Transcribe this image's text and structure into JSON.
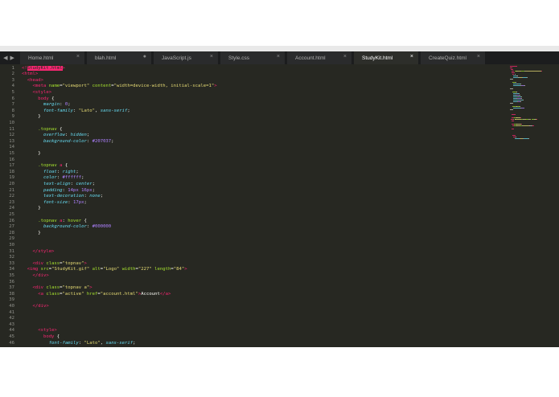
{
  "tabs": [
    {
      "label": "Home.html",
      "close": "×",
      "active": false
    },
    {
      "label": "blah.html",
      "close": "●",
      "active": false
    },
    {
      "label": "JavaScript.js",
      "close": "×",
      "active": false
    },
    {
      "label": "Style.css",
      "close": "×",
      "active": false
    },
    {
      "label": "Account.html",
      "close": "×",
      "active": false
    },
    {
      "label": "StudyKit.html",
      "close": "×",
      "active": true
    },
    {
      "label": "CreateQuiz.html",
      "close": "×",
      "active": false
    }
  ],
  "nav": {
    "back": "◀",
    "forward": "▶"
  },
  "lines": [
    {
      "n": "1",
      "segs": [
        [
          "t",
          "<!"
        ],
        [
          "hl",
          "StudyKit.html"
        ],
        [
          "t",
          ">"
        ]
      ]
    },
    {
      "n": "2",
      "segs": [
        [
          "t",
          "<html>"
        ]
      ]
    },
    {
      "n": "3",
      "segs": [
        [
          "",
          "  "
        ],
        [
          "t",
          "<head>"
        ]
      ]
    },
    {
      "n": "4",
      "segs": [
        [
          "",
          "    "
        ],
        [
          "t",
          "<meta "
        ],
        [
          "a",
          "name"
        ],
        [
          "",
          "="
        ],
        [
          "s",
          "\"viewport\""
        ],
        [
          "",
          " "
        ],
        [
          "a",
          "content"
        ],
        [
          "",
          "="
        ],
        [
          "s",
          "\"width=device-width, initial-scale=1\""
        ],
        [
          "t",
          ">"
        ]
      ]
    },
    {
      "n": "5",
      "segs": [
        [
          "",
          "    "
        ],
        [
          "t",
          "<style>"
        ]
      ]
    },
    {
      "n": "6",
      "segs": [
        [
          "",
          "      "
        ],
        [
          "t",
          "body"
        ],
        [
          "",
          " {"
        ]
      ]
    },
    {
      "n": "7",
      "segs": [
        [
          "",
          "        "
        ],
        [
          "p",
          "margin"
        ],
        [
          "",
          ": "
        ],
        [
          "n",
          "0"
        ],
        [
          "",
          ";"
        ]
      ]
    },
    {
      "n": "8",
      "segs": [
        [
          "",
          "        "
        ],
        [
          "p",
          "font-family"
        ],
        [
          "",
          ": "
        ],
        [
          "s",
          "\"Lato\""
        ],
        [
          "",
          ", "
        ],
        [
          "p",
          "sans-serif"
        ],
        [
          "",
          ";"
        ]
      ]
    },
    {
      "n": "9",
      "segs": [
        [
          "",
          "      }"
        ]
      ]
    },
    {
      "n": "10",
      "segs": [
        [
          "",
          ""
        ]
      ]
    },
    {
      "n": "11",
      "segs": [
        [
          "",
          "      "
        ],
        [
          "sel",
          ".topnav"
        ],
        [
          "",
          " {"
        ]
      ]
    },
    {
      "n": "12",
      "segs": [
        [
          "",
          "        "
        ],
        [
          "p",
          "overflow"
        ],
        [
          "",
          ": "
        ],
        [
          "p",
          "hidden"
        ],
        [
          "",
          ";"
        ]
      ]
    },
    {
      "n": "13",
      "segs": [
        [
          "",
          "        "
        ],
        [
          "p",
          "background-color"
        ],
        [
          "",
          ": "
        ],
        [
          "n",
          "#207037"
        ],
        [
          "",
          ";"
        ]
      ]
    },
    {
      "n": "14",
      "segs": [
        [
          "",
          ""
        ]
      ]
    },
    {
      "n": "15",
      "segs": [
        [
          "",
          "      }"
        ]
      ]
    },
    {
      "n": "16",
      "segs": [
        [
          "",
          ""
        ]
      ]
    },
    {
      "n": "17",
      "segs": [
        [
          "",
          "      "
        ],
        [
          "sel",
          ".topnav "
        ],
        [
          "t",
          "a"
        ],
        [
          "",
          " {"
        ]
      ]
    },
    {
      "n": "18",
      "segs": [
        [
          "",
          "        "
        ],
        [
          "p",
          "float"
        ],
        [
          "",
          ": "
        ],
        [
          "p",
          "right"
        ],
        [
          "",
          ";"
        ]
      ]
    },
    {
      "n": "19",
      "segs": [
        [
          "",
          "        "
        ],
        [
          "p",
          "color"
        ],
        [
          "",
          ": "
        ],
        [
          "n",
          "#ffffff"
        ],
        [
          "",
          ";"
        ]
      ]
    },
    {
      "n": "20",
      "segs": [
        [
          "",
          "        "
        ],
        [
          "p",
          "text-align"
        ],
        [
          "",
          ": "
        ],
        [
          "p",
          "center"
        ],
        [
          "",
          ";"
        ]
      ]
    },
    {
      "n": "21",
      "segs": [
        [
          "",
          "        "
        ],
        [
          "p",
          "padding"
        ],
        [
          "",
          ": "
        ],
        [
          "n",
          "14px 16px"
        ],
        [
          "",
          ";"
        ]
      ]
    },
    {
      "n": "22",
      "segs": [
        [
          "",
          "        "
        ],
        [
          "p",
          "text-decoration"
        ],
        [
          "",
          ": "
        ],
        [
          "p",
          "none"
        ],
        [
          "",
          ";"
        ]
      ]
    },
    {
      "n": "23",
      "segs": [
        [
          "",
          "        "
        ],
        [
          "p",
          "font-size"
        ],
        [
          "",
          ": "
        ],
        [
          "n",
          "17px"
        ],
        [
          "",
          ";"
        ]
      ]
    },
    {
      "n": "24",
      "segs": [
        [
          "",
          "      }"
        ]
      ]
    },
    {
      "n": "25",
      "segs": [
        [
          "",
          ""
        ]
      ]
    },
    {
      "n": "26",
      "segs": [
        [
          "",
          "      "
        ],
        [
          "sel",
          ".topnav "
        ],
        [
          "t",
          "a"
        ],
        [
          "",
          ": "
        ],
        [
          "a",
          "hover"
        ],
        [
          "",
          " {"
        ]
      ]
    },
    {
      "n": "27",
      "segs": [
        [
          "",
          "        "
        ],
        [
          "p",
          "background-color"
        ],
        [
          "",
          ": "
        ],
        [
          "n",
          "#000000"
        ]
      ]
    },
    {
      "n": "28",
      "segs": [
        [
          "",
          "      }"
        ]
      ]
    },
    {
      "n": "29",
      "segs": [
        [
          "",
          ""
        ]
      ]
    },
    {
      "n": "30",
      "segs": [
        [
          "",
          ""
        ]
      ]
    },
    {
      "n": "31",
      "segs": [
        [
          "",
          "    "
        ],
        [
          "t",
          "</style>"
        ]
      ]
    },
    {
      "n": "32",
      "segs": [
        [
          "",
          ""
        ]
      ]
    },
    {
      "n": "33",
      "segs": [
        [
          "",
          "    "
        ],
        [
          "t",
          "<div "
        ],
        [
          "a",
          "class"
        ],
        [
          "",
          "="
        ],
        [
          "s",
          "\"topnav\""
        ],
        [
          "t",
          ">"
        ]
      ]
    },
    {
      "n": "34",
      "segs": [
        [
          "",
          "  "
        ],
        [
          "t",
          "<img "
        ],
        [
          "a",
          "src"
        ],
        [
          "",
          "="
        ],
        [
          "s",
          "\"StudyKit.gif\""
        ],
        [
          "",
          " "
        ],
        [
          "a",
          "alt"
        ],
        [
          "",
          "="
        ],
        [
          "s",
          "\"Logo\""
        ],
        [
          "",
          " "
        ],
        [
          "a",
          "width"
        ],
        [
          "",
          "="
        ],
        [
          "s",
          "\"227\""
        ],
        [
          "",
          " "
        ],
        [
          "a",
          "length"
        ],
        [
          "",
          "="
        ],
        [
          "s",
          "\"84\""
        ],
        [
          "t",
          ">"
        ]
      ]
    },
    {
      "n": "35",
      "segs": [
        [
          "",
          "    "
        ],
        [
          "t",
          "</div>"
        ]
      ]
    },
    {
      "n": "36",
      "segs": [
        [
          "",
          ""
        ]
      ]
    },
    {
      "n": "37",
      "segs": [
        [
          "",
          "    "
        ],
        [
          "t",
          "<div "
        ],
        [
          "a",
          "class"
        ],
        [
          "",
          "="
        ],
        [
          "s",
          "\"topnav a\""
        ],
        [
          "t",
          ">"
        ]
      ]
    },
    {
      "n": "38",
      "segs": [
        [
          "",
          "      "
        ],
        [
          "t",
          "<a "
        ],
        [
          "a",
          "class"
        ],
        [
          "",
          "="
        ],
        [
          "s",
          "\"active\""
        ],
        [
          "",
          " "
        ],
        [
          "a",
          "href"
        ],
        [
          "",
          "="
        ],
        [
          "s",
          "\"account.html\""
        ],
        [
          "t",
          ">"
        ],
        [
          "",
          "Account"
        ],
        [
          "t",
          "</a>"
        ]
      ]
    },
    {
      "n": "39",
      "segs": [
        [
          "",
          ""
        ]
      ]
    },
    {
      "n": "40",
      "segs": [
        [
          "",
          "    "
        ],
        [
          "t",
          "</div>"
        ]
      ]
    },
    {
      "n": "41",
      "segs": [
        [
          "",
          ""
        ]
      ]
    },
    {
      "n": "42",
      "segs": [
        [
          "",
          ""
        ]
      ]
    },
    {
      "n": "43",
      "segs": [
        [
          "",
          ""
        ]
      ]
    },
    {
      "n": "44",
      "segs": [
        [
          "",
          "      "
        ],
        [
          "t",
          "<style>"
        ]
      ]
    },
    {
      "n": "45",
      "segs": [
        [
          "",
          "        "
        ],
        [
          "t",
          "body"
        ],
        [
          "",
          " {"
        ]
      ]
    },
    {
      "n": "46",
      "segs": [
        [
          "",
          "          "
        ],
        [
          "p",
          "font-family"
        ],
        [
          "",
          ": "
        ],
        [
          "s",
          "\"Lato\""
        ],
        [
          "",
          ", "
        ],
        [
          "p",
          "sans-serif"
        ],
        [
          "",
          ";"
        ]
      ]
    }
  ],
  "colors": {
    "editor_bg": "#272822",
    "tag": "#f92672",
    "attr": "#a6e22e",
    "string": "#e6db74",
    "property": "#66d9ef",
    "number": "#ae81ff",
    "tabbar_bg": "#1c1d1e"
  }
}
